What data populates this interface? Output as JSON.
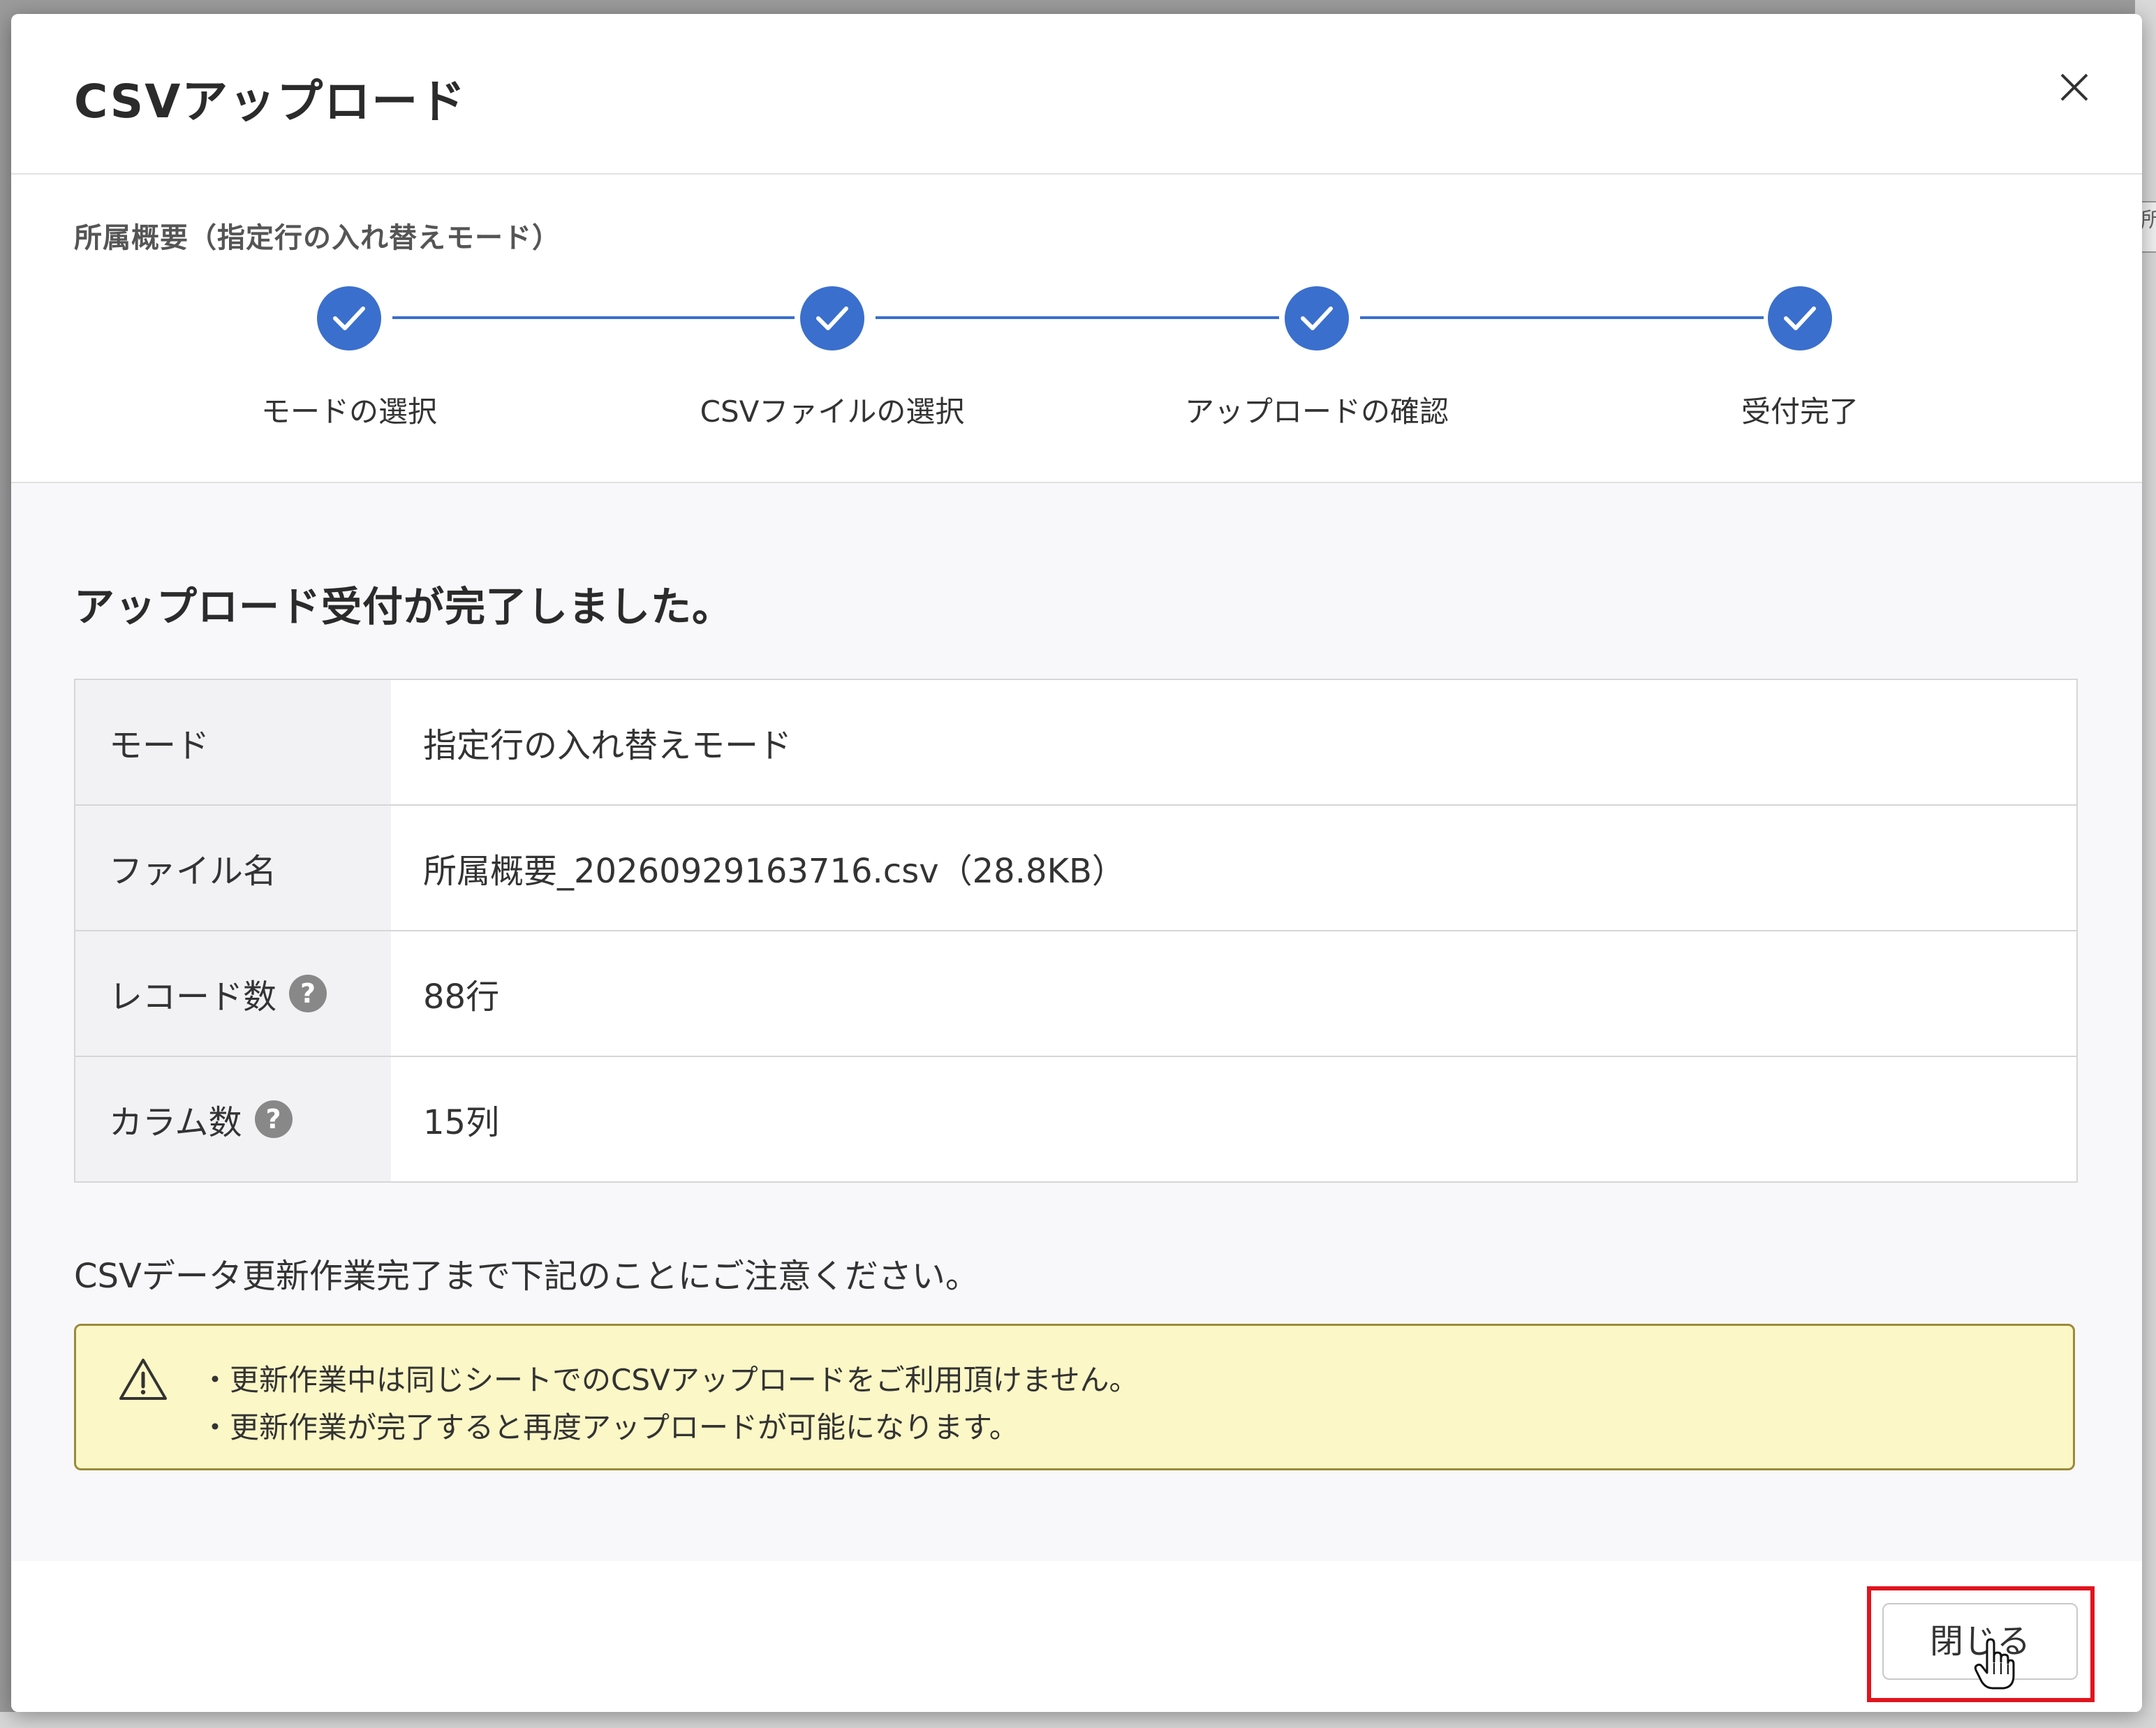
{
  "dialog": {
    "title": "CSVアップロード",
    "close_icon": "close-icon"
  },
  "steps": {
    "subtitle": "所属概要（指定行の入れ替えモード）",
    "items": [
      {
        "label": "モードの選択",
        "status": "done"
      },
      {
        "label": "CSVファイルの選択",
        "status": "done"
      },
      {
        "label": "アップロードの確認",
        "status": "done"
      },
      {
        "label": "受付完了",
        "status": "done"
      }
    ],
    "color": "#3a6fcd"
  },
  "result": {
    "message": "アップロード受付が完了しました。",
    "rows": [
      {
        "key": "モード",
        "value": "指定行の入れ替えモード",
        "help": false
      },
      {
        "key": "ファイル名",
        "value": "所属概要_20260929163716.csv（28.8KB）",
        "help": false
      },
      {
        "key": "レコード数",
        "value": "88行",
        "help": true
      },
      {
        "key": "カラム数",
        "value": "15列",
        "help": true
      }
    ],
    "help_icon_text": "?"
  },
  "notice": {
    "intro": "CSVデータ更新作業完了まで下記のことにご注意ください。",
    "lines": [
      "・更新作業中は同じシートでのCSVアップロードをご利用頂けません。",
      "・更新作業が完了すると再度アップロードが可能になります。"
    ],
    "icon": "warning-icon"
  },
  "footer": {
    "close_label": "閉じる",
    "highlight_color": "#e0141e"
  },
  "background": {
    "tab_fragment": "所"
  }
}
